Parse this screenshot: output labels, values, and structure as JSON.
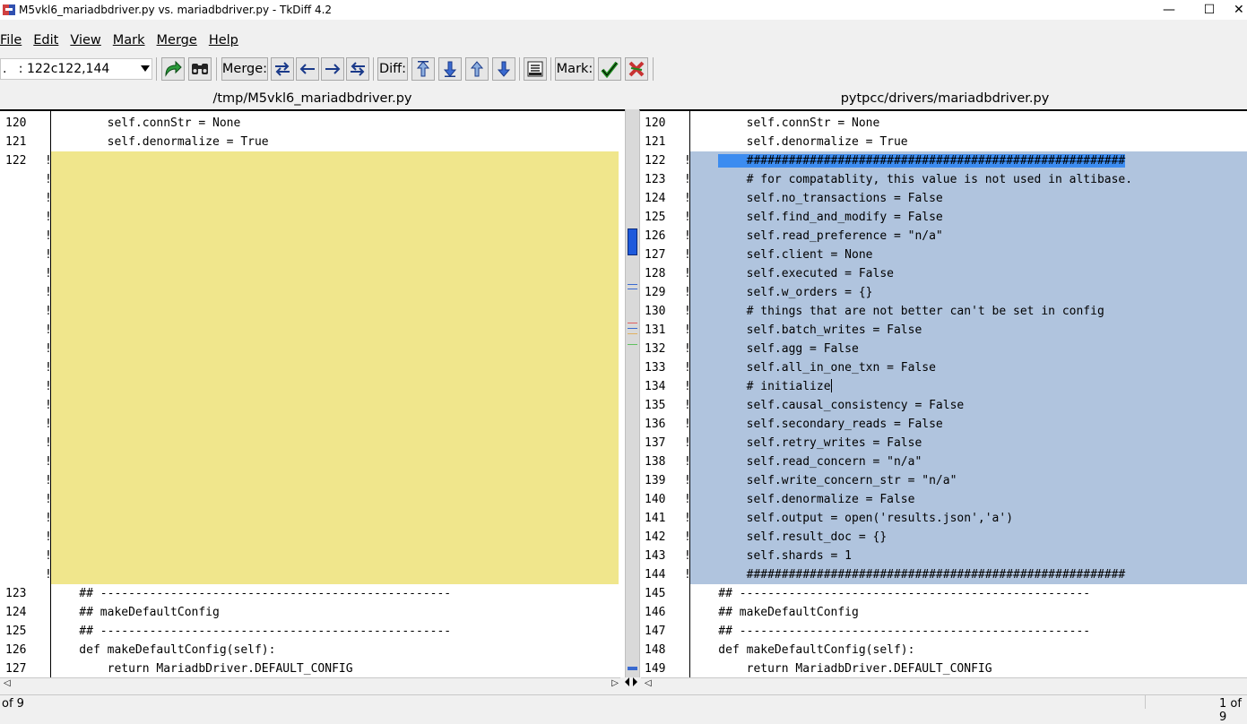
{
  "window": {
    "title": "M5vkl6_mariadbdriver.py vs. mariadbdriver.py - TkDiff 4.2",
    "minimize_glyph": "—",
    "maximize_glyph": "☐",
    "close_glyph": "✕"
  },
  "menu": [
    {
      "label": "File"
    },
    {
      "label": "Edit"
    },
    {
      "label": "View"
    },
    {
      "label": "Mark"
    },
    {
      "label": "Merge"
    },
    {
      "label": "Help"
    }
  ],
  "toolbar": {
    "diff_combo_value": ".   : 122c122,144",
    "merge_label": "Merge:",
    "diff_label": "Diff:",
    "mark_label": "Mark:",
    "icons": [
      "rediff-icon",
      "search-icon",
      "merge-choose-left-right-icon",
      "merge-choose-left-icon",
      "merge-choose-right-icon",
      "merge-choose-right-left-icon",
      "first-diff-icon",
      "next-diff-icon",
      "prev-diff-icon",
      "last-diff-icon",
      "center-current-diff-icon",
      "mark-diff-icon",
      "clear-mark-icon"
    ]
  },
  "left_file": "/tmp/M5vkl6_mariadbdriver.py",
  "right_file": "pytpcc/drivers/mariadbdriver.py",
  "left_lines": [
    {
      "n": "120",
      "m": "",
      "t": "        self.connStr = None",
      "hl": ""
    },
    {
      "n": "121",
      "m": "",
      "t": "        self.denormalize = True",
      "hl": ""
    },
    {
      "n": "122",
      "m": "!",
      "t": "",
      "hl": "yellow"
    },
    {
      "n": "",
      "m": "!",
      "t": "",
      "hl": "yellow"
    },
    {
      "n": "",
      "m": "!",
      "t": "",
      "hl": "yellow"
    },
    {
      "n": "",
      "m": "!",
      "t": "",
      "hl": "yellow"
    },
    {
      "n": "",
      "m": "!",
      "t": "",
      "hl": "yellow"
    },
    {
      "n": "",
      "m": "!",
      "t": "",
      "hl": "yellow"
    },
    {
      "n": "",
      "m": "!",
      "t": "",
      "hl": "yellow"
    },
    {
      "n": "",
      "m": "!",
      "t": "",
      "hl": "yellow"
    },
    {
      "n": "",
      "m": "!",
      "t": "",
      "hl": "yellow"
    },
    {
      "n": "",
      "m": "!",
      "t": "",
      "hl": "yellow"
    },
    {
      "n": "",
      "m": "!",
      "t": "",
      "hl": "yellow"
    },
    {
      "n": "",
      "m": "!",
      "t": "",
      "hl": "yellow"
    },
    {
      "n": "",
      "m": "!",
      "t": "",
      "hl": "yellow"
    },
    {
      "n": "",
      "m": "!",
      "t": "",
      "hl": "yellow"
    },
    {
      "n": "",
      "m": "!",
      "t": "",
      "hl": "yellow"
    },
    {
      "n": "",
      "m": "!",
      "t": "",
      "hl": "yellow"
    },
    {
      "n": "",
      "m": "!",
      "t": "",
      "hl": "yellow"
    },
    {
      "n": "",
      "m": "!",
      "t": "",
      "hl": "yellow"
    },
    {
      "n": "",
      "m": "!",
      "t": "",
      "hl": "yellow"
    },
    {
      "n": "",
      "m": "!",
      "t": "",
      "hl": "yellow"
    },
    {
      "n": "",
      "m": "!",
      "t": "",
      "hl": "yellow"
    },
    {
      "n": "",
      "m": "!",
      "t": "",
      "hl": "yellow"
    },
    {
      "n": "",
      "m": "!",
      "t": "",
      "hl": "yellow"
    },
    {
      "n": "123",
      "m": "",
      "t": "    ## --------------------------------------------------",
      "hl": ""
    },
    {
      "n": "124",
      "m": "",
      "t": "    ## makeDefaultConfig",
      "hl": ""
    },
    {
      "n": "125",
      "m": "",
      "t": "    ## --------------------------------------------------",
      "hl": ""
    },
    {
      "n": "126",
      "m": "",
      "t": "    def makeDefaultConfig(self):",
      "hl": ""
    },
    {
      "n": "127",
      "m": "",
      "t": "        return MariadbDriver.DEFAULT_CONFIG",
      "hl": ""
    }
  ],
  "right_lines": [
    {
      "n": "120",
      "m": "",
      "t": "        self.connStr = None",
      "hl": ""
    },
    {
      "n": "121",
      "m": "",
      "t": "        self.denormalize = True",
      "hl": ""
    },
    {
      "n": "122",
      "m": "!",
      "t": "",
      "hl": "blue",
      "sel_prefix": "    ",
      "sel": "    ######################################################"
    },
    {
      "n": "123",
      "m": "!",
      "t": "        # for compatablity, this value is not used in altibase.",
      "hl": "blue"
    },
    {
      "n": "124",
      "m": "!",
      "t": "        self.no_transactions = False",
      "hl": "blue"
    },
    {
      "n": "125",
      "m": "!",
      "t": "        self.find_and_modify = False",
      "hl": "blue"
    },
    {
      "n": "126",
      "m": "!",
      "t": "        self.read_preference = \"n/a\"",
      "hl": "blue"
    },
    {
      "n": "127",
      "m": "!",
      "t": "        self.client = None",
      "hl": "blue"
    },
    {
      "n": "128",
      "m": "!",
      "t": "        self.executed = False",
      "hl": "blue"
    },
    {
      "n": "129",
      "m": "!",
      "t": "        self.w_orders = {}",
      "hl": "blue"
    },
    {
      "n": "130",
      "m": "!",
      "t": "        # things that are not better can't be set in config",
      "hl": "blue"
    },
    {
      "n": "131",
      "m": "!",
      "t": "        self.batch_writes = False",
      "hl": "blue"
    },
    {
      "n": "132",
      "m": "!",
      "t": "        self.agg = False",
      "hl": "blue"
    },
    {
      "n": "133",
      "m": "!",
      "t": "        self.all_in_one_txn = False",
      "hl": "blue"
    },
    {
      "n": "134",
      "m": "!",
      "t": "        # initialize",
      "hl": "blue",
      "caret": true
    },
    {
      "n": "135",
      "m": "!",
      "t": "        self.causal_consistency = False",
      "hl": "blue"
    },
    {
      "n": "136",
      "m": "!",
      "t": "        self.secondary_reads = False",
      "hl": "blue"
    },
    {
      "n": "137",
      "m": "!",
      "t": "        self.retry_writes = False",
      "hl": "blue"
    },
    {
      "n": "138",
      "m": "!",
      "t": "        self.read_concern = \"n/a\"",
      "hl": "blue"
    },
    {
      "n": "139",
      "m": "!",
      "t": "        self.write_concern_str = \"n/a\"",
      "hl": "blue"
    },
    {
      "n": "140",
      "m": "!",
      "t": "        self.denormalize = False",
      "hl": "blue"
    },
    {
      "n": "141",
      "m": "!",
      "t": "        self.output = open('results.json','a')",
      "hl": "blue"
    },
    {
      "n": "142",
      "m": "!",
      "t": "        self.result_doc = {}",
      "hl": "blue"
    },
    {
      "n": "143",
      "m": "!",
      "t": "        self.shards = 1",
      "hl": "blue"
    },
    {
      "n": "144",
      "m": "!",
      "t": "        ######################################################",
      "hl": "blue"
    },
    {
      "n": "145",
      "m": "",
      "t": "    ## --------------------------------------------------",
      "hl": ""
    },
    {
      "n": "146",
      "m": "",
      "t": "    ## makeDefaultConfig",
      "hl": ""
    },
    {
      "n": "147",
      "m": "",
      "t": "    ## --------------------------------------------------",
      "hl": ""
    },
    {
      "n": "148",
      "m": "",
      "t": "    def makeDefaultConfig(self):",
      "hl": ""
    },
    {
      "n": "149",
      "m": "",
      "t": "        return MariadbDriver.DEFAULT_CONFIG",
      "hl": ""
    }
  ],
  "status": {
    "left": "of 9",
    "right": "1 of 9"
  },
  "colors": {
    "left_change_bg": "#f0e68c",
    "right_change_bg": "#b0c4de",
    "selection_bg": "#3c8cf0"
  }
}
